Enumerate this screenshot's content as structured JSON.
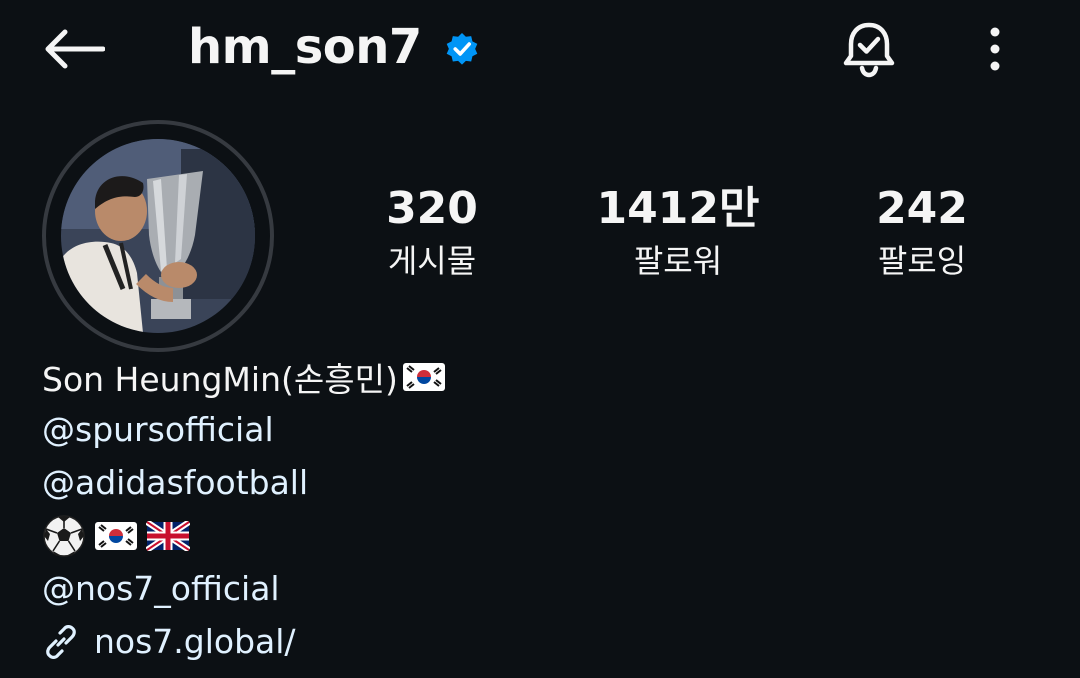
{
  "header": {
    "username": "hm_son7",
    "back_icon": "arrow-left-icon",
    "verified_icon": "verified-badge-icon",
    "notifications_icon": "bell-check-icon",
    "more_icon": "more-vertical-icon"
  },
  "profile": {
    "avatar_icon": "profile-photo",
    "stats": [
      {
        "value": "320",
        "label": "게시물"
      },
      {
        "value": "1412만",
        "label": "팔로워"
      },
      {
        "value": "242",
        "label": "팔로잉"
      }
    ]
  },
  "bio": {
    "name": "Son HeungMin(손흥민)",
    "name_flag": "south-korea-flag",
    "mentions": [
      "@spursofficial",
      "@adidasfootball"
    ],
    "emoji_line": [
      "soccer-ball",
      "south-korea-flag",
      "uk-flag"
    ],
    "mention_after": "@nos7_official",
    "link_icon": "link-icon",
    "link": "nos7.global/"
  },
  "colors": {
    "background": "#0c1014",
    "text": "#f5f5f5",
    "link": "#e0f1ff",
    "verified": "#0095f6",
    "avatar_ring": "#363a40"
  }
}
